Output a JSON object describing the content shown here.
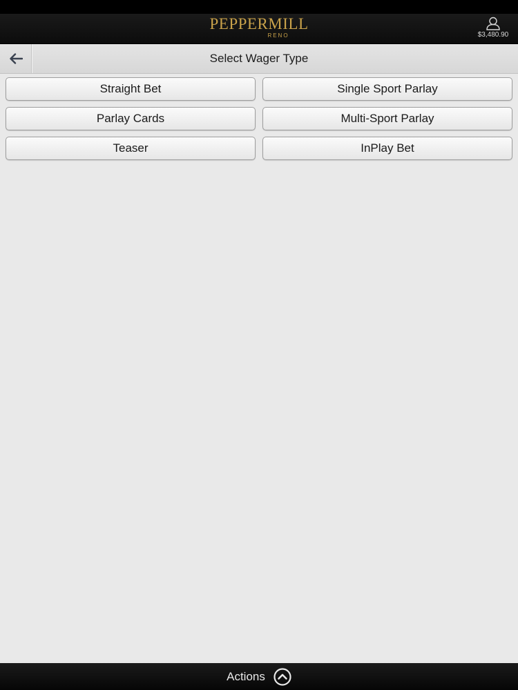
{
  "app": {
    "logo_text": "PEPPERMILL",
    "logo_subtext": "RENO",
    "brand_color": "#c9a24a"
  },
  "account": {
    "icon": "user-icon",
    "balance": "$3,480.90"
  },
  "header": {
    "back_icon": "arrow-left-icon",
    "title": "Select Wager Type"
  },
  "wager_types": [
    {
      "label": "Straight Bet"
    },
    {
      "label": "Single Sport Parlay"
    },
    {
      "label": "Parlay Cards"
    },
    {
      "label": "Multi-Sport Parlay"
    },
    {
      "label": "Teaser"
    },
    {
      "label": "InPlay Bet"
    }
  ],
  "footer": {
    "actions_label": "Actions",
    "actions_icon": "chevron-up-circle-icon"
  }
}
